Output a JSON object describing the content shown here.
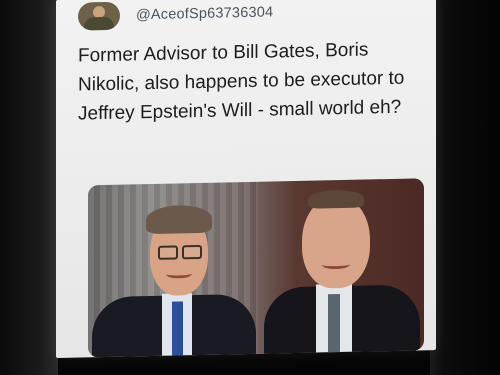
{
  "tweet": {
    "handle": "@AceofSp63736304",
    "text": "Former Advisor to Bill Gates, Boris Nikolic, also happens to be executor to Jeffrey Epstein's Will - small world eh?"
  },
  "icons": {
    "avatar": "avatar-soldier-icon"
  },
  "colors": {
    "screen_bg": "#efefef",
    "text": "#1d1d1d",
    "handle": "#4a5560"
  }
}
